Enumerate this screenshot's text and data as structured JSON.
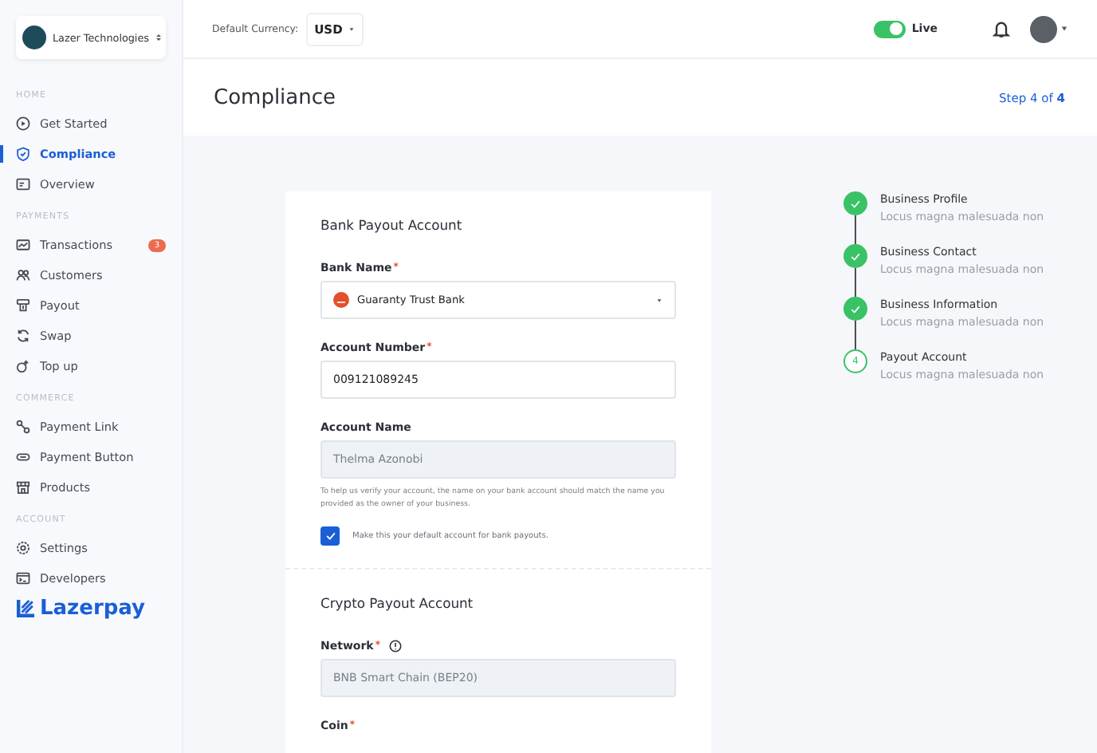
{
  "workspace": {
    "name": "Lazer Technologies"
  },
  "sidebar": {
    "sections": [
      {
        "title": "HOME",
        "items": [
          {
            "label": "Get Started",
            "selected": false
          },
          {
            "label": "Compliance",
            "selected": true
          },
          {
            "label": "Overview",
            "selected": false
          }
        ]
      },
      {
        "title": "PAYMENTS",
        "items": [
          {
            "label": "Transactions",
            "selected": false,
            "badge": "3"
          },
          {
            "label": "Customers",
            "selected": false
          },
          {
            "label": "Payout",
            "selected": false
          },
          {
            "label": "Swap",
            "selected": false
          },
          {
            "label": "Top up",
            "selected": false
          }
        ]
      },
      {
        "title": "COMMERCE",
        "items": [
          {
            "label": "Payment Link",
            "selected": false
          },
          {
            "label": "Payment Button",
            "selected": false
          },
          {
            "label": "Products",
            "selected": false
          }
        ]
      },
      {
        "title": "ACCOUNT",
        "items": [
          {
            "label": "Settings",
            "selected": false
          },
          {
            "label": "Developers",
            "selected": false
          }
        ]
      }
    ],
    "brand": "Lazerpay"
  },
  "topbar": {
    "currency_label": "Default Currency:",
    "currency": "USD",
    "live": {
      "label": "Live",
      "on": true
    }
  },
  "header": {
    "title": "Compliance",
    "step_prefix": "Step 4 of",
    "step_total": "4"
  },
  "form": {
    "sections": [
      {
        "title": "Bank Payout Account",
        "fields": [
          {
            "kind": "select",
            "label": "Bank Name",
            "required_mark": "*",
            "value": "Guaranty Trust Bank"
          },
          {
            "kind": "input",
            "label": "Account Number",
            "required_mark": "*",
            "value": "009121089245"
          },
          {
            "kind": "readonly",
            "label": "Account Name",
            "disabled": true,
            "value": "Thelma Azonobi",
            "help": "To help us verify your account, the name on your bank account should match the name you provided as the owner of your business."
          },
          {
            "kind": "checkbox",
            "label": "Make this your default account for bank payouts.",
            "checked": true
          }
        ]
      },
      {
        "title": "Crypto Payout Account",
        "fields": [
          {
            "kind": "readonly",
            "label": "Network",
            "required_mark": "*",
            "info": true,
            "disabled": true,
            "value": "BNB Smart Chain (BEP20)"
          },
          {
            "kind": "label",
            "label": "Coin",
            "required_mark": "*"
          }
        ]
      }
    ]
  },
  "steps": [
    {
      "title": "Business Profile",
      "subtitle": "Locus magna malesuada non",
      "done": true
    },
    {
      "title": "Business Contact",
      "subtitle": "Locus magna malesuada non",
      "done": true
    },
    {
      "title": "Business Information",
      "subtitle": "Locus magna malesuada non",
      "done": true
    },
    {
      "title": "Payout Account",
      "subtitle": "Locus magna malesuada non",
      "done": false,
      "number": "4"
    }
  ]
}
